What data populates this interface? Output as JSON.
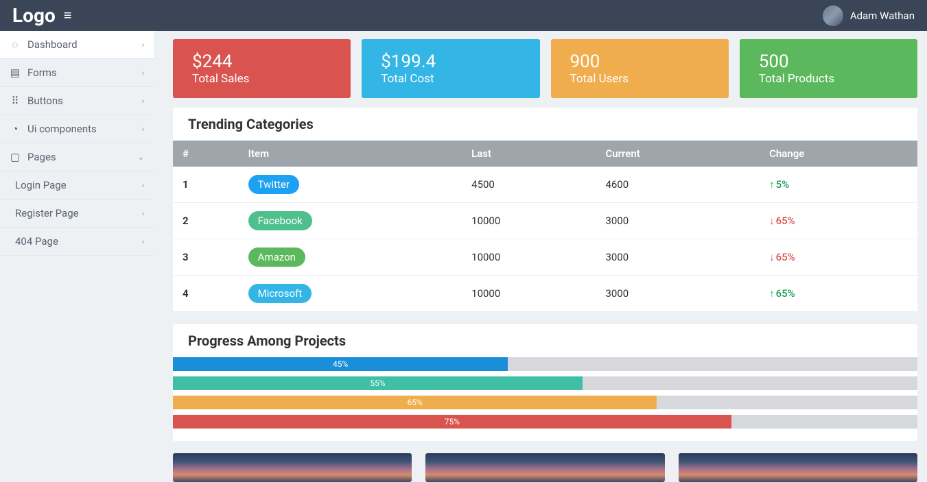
{
  "header": {
    "logo": "Logo",
    "user": "Adam Wathan"
  },
  "sidebar": {
    "items": [
      {
        "label": "Dashboard",
        "icon": "◌",
        "active": true,
        "chev": "›"
      },
      {
        "label": "Forms",
        "icon": "▤",
        "chev": "›"
      },
      {
        "label": "Buttons",
        "icon": "⠿",
        "chev": "›"
      },
      {
        "label": "Ui components",
        "icon": "◔",
        "chev": "›"
      },
      {
        "label": "Pages",
        "icon": "▢",
        "chev": "⌄"
      }
    ],
    "subitems": [
      {
        "label": "Login Page",
        "chev": "›"
      },
      {
        "label": "Register Page",
        "chev": "›"
      },
      {
        "label": "404 Page",
        "chev": "›"
      }
    ]
  },
  "cards": [
    {
      "value": "$244",
      "label": "Total Sales",
      "cls": "c-red"
    },
    {
      "value": "$199.4",
      "label": "Total Cost",
      "cls": "c-blue"
    },
    {
      "value": "900",
      "label": "Total Users",
      "cls": "c-orange"
    },
    {
      "value": "500",
      "label": "Total Products",
      "cls": "c-green"
    }
  ],
  "trending": {
    "title": "Trending Categories",
    "headers": [
      "#",
      "Item",
      "Last",
      "Current",
      "Change"
    ],
    "rows": [
      {
        "n": "1",
        "item": "Twitter",
        "pill": "p-twitter",
        "last": "4500",
        "current": "4600",
        "dir": "up",
        "change": "5%"
      },
      {
        "n": "2",
        "item": "Facebook",
        "pill": "p-facebook",
        "last": "10000",
        "current": "3000",
        "dir": "down",
        "change": "65%"
      },
      {
        "n": "3",
        "item": "Amazon",
        "pill": "p-amazon",
        "last": "10000",
        "current": "3000",
        "dir": "down",
        "change": "65%"
      },
      {
        "n": "4",
        "item": "Microsoft",
        "pill": "p-microsoft",
        "last": "10000",
        "current": "3000",
        "dir": "up",
        "change": "65%"
      }
    ]
  },
  "progress": {
    "title": "Progress Among Projects",
    "bars": [
      {
        "pct": 45,
        "label": "45%",
        "cls": "pb-blue"
      },
      {
        "pct": 55,
        "label": "55%",
        "cls": "pb-teal"
      },
      {
        "pct": 65,
        "label": "65%",
        "cls": "pb-orange"
      },
      {
        "pct": 75,
        "label": "75%",
        "cls": "pb-red"
      }
    ]
  }
}
